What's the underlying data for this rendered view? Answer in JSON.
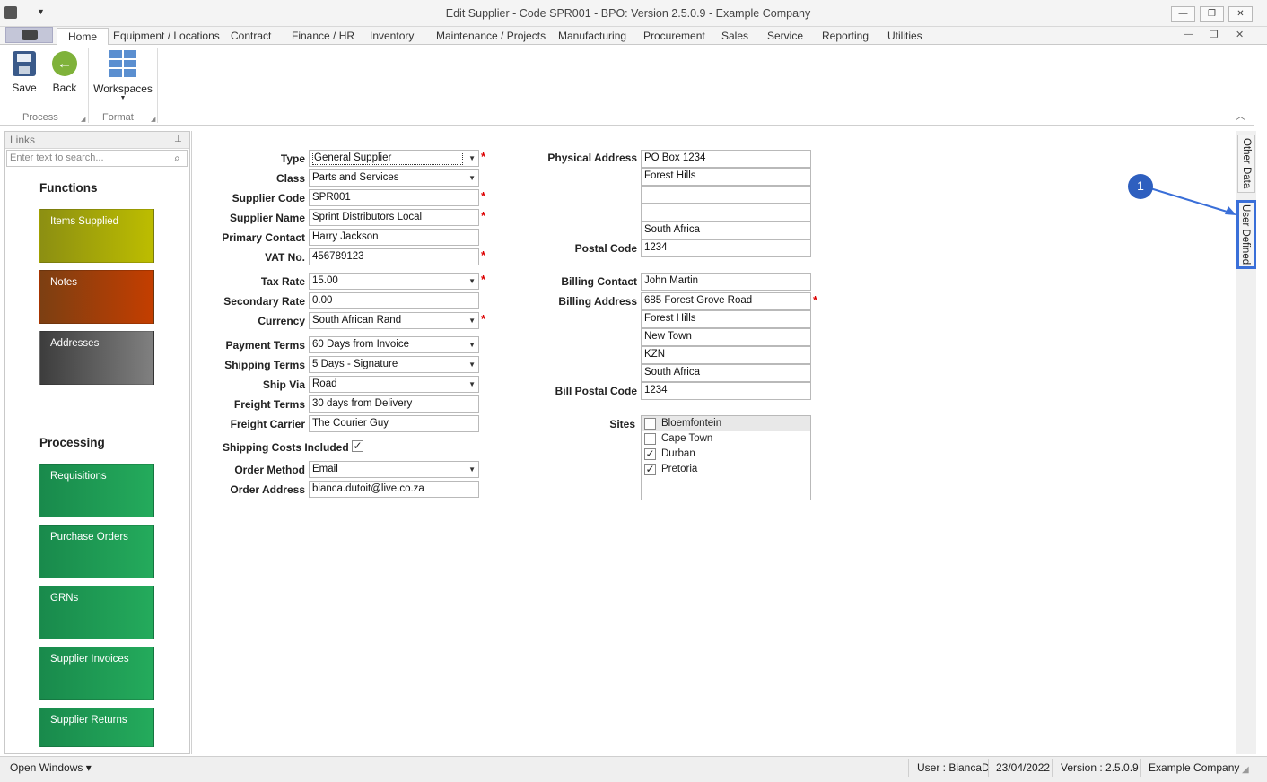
{
  "window": {
    "title": "Edit Supplier - Code SPR001 - BPO: Version 2.5.0.9 - Example Company",
    "minimize": "—",
    "maximize": "❐",
    "close": "✕",
    "sub_minimize": "—",
    "sub_restore": "❐",
    "sub_close": "✕"
  },
  "tabs": [
    "Home",
    "Equipment / Locations",
    "Contract",
    "Finance / HR",
    "Inventory",
    "Maintenance / Projects",
    "Manufacturing",
    "Procurement",
    "Sales",
    "Service",
    "Reporting",
    "Utilities"
  ],
  "ribbon": {
    "save": "Save",
    "back": "Back",
    "workspaces": "Workspaces",
    "group_process": "Process",
    "group_format": "Format"
  },
  "links": {
    "title": "Links",
    "search_placeholder": "Enter text to search...",
    "functions_title": "Functions",
    "functions": [
      {
        "label": "Items Supplied",
        "color": "#a8aa1a"
      },
      {
        "label": "Notes",
        "color": "#9a4414"
      },
      {
        "label": "Addresses",
        "color": "#5d5d5d"
      }
    ],
    "processing_title": "Processing",
    "processing": [
      {
        "label": "Requisitions",
        "color": "#1e9e56"
      },
      {
        "label": "Purchase Orders",
        "color": "#1e9e56"
      },
      {
        "label": "GRNs",
        "color": "#1e9e56"
      },
      {
        "label": "Supplier Invoices",
        "color": "#1e9e56"
      },
      {
        "label": "Supplier Returns",
        "color": "#1e9e56"
      }
    ]
  },
  "form": {
    "type_label": "Type",
    "type_value": "General Supplier",
    "class_label": "Class",
    "class_value": "Parts and Services",
    "code_label": "Supplier Code",
    "code_value": "SPR001",
    "name_label": "Supplier Name",
    "name_value": "Sprint Distributors Local",
    "contact_label": "Primary Contact",
    "contact_value": "Harry Jackson",
    "vat_label": "VAT No.",
    "vat_value": "456789123",
    "taxrate_label": "Tax Rate",
    "taxrate_value": "15.00",
    "secrate_label": "Secondary Rate",
    "secrate_value": "0.00",
    "currency_label": "Currency",
    "currency_value": "South African Rand",
    "payterms_label": "Payment Terms",
    "payterms_value": "60 Days from Invoice",
    "shipterms_label": "Shipping Terms",
    "shipterms_value": "5 Days - Signature",
    "shipvia_label": "Ship Via",
    "shipvia_value": "Road",
    "freightterms_label": "Freight Terms",
    "freightterms_value": "30 days from Delivery",
    "carrier_label": "Freight Carrier",
    "carrier_value": "The Courier Guy",
    "shipcosts_label": "Shipping Costs Included",
    "shipcosts_checked": "✓",
    "ordermethod_label": "Order Method",
    "ordermethod_value": "Email",
    "orderaddress_label": "Order Address",
    "orderaddress_value": "bianca.dutoit@live.co.za",
    "physical_label": "Physical Address",
    "physical_lines": [
      "PO Box 1234",
      "Forest Hills",
      "",
      "",
      "South Africa"
    ],
    "postal_label": "Postal Code",
    "postal_value": "1234",
    "billcontact_label": "Billing Contact",
    "billcontact_value": "John Martin",
    "billaddress_label": "Billing Address",
    "billing_lines": [
      "685 Forest Grove Road",
      "Forest Hills",
      "New Town",
      "KZN",
      "South Africa"
    ],
    "billpostal_label": "Bill Postal Code",
    "billpostal_value": "1234",
    "sites_label": "Sites",
    "sites": [
      {
        "name": "Bloemfontein",
        "checked": ""
      },
      {
        "name": "Cape Town",
        "checked": ""
      },
      {
        "name": "Durban",
        "checked": "✓"
      },
      {
        "name": "Pretoria",
        "checked": "✓"
      }
    ]
  },
  "side_tabs": {
    "other": "Other Data",
    "user": "User Defined"
  },
  "callout": "1",
  "status": {
    "open_windows": "Open Windows ▾",
    "user": "User : BiancaD",
    "date": "23/04/2022",
    "version": "Version : 2.5.0.9",
    "company": "Example Company"
  }
}
